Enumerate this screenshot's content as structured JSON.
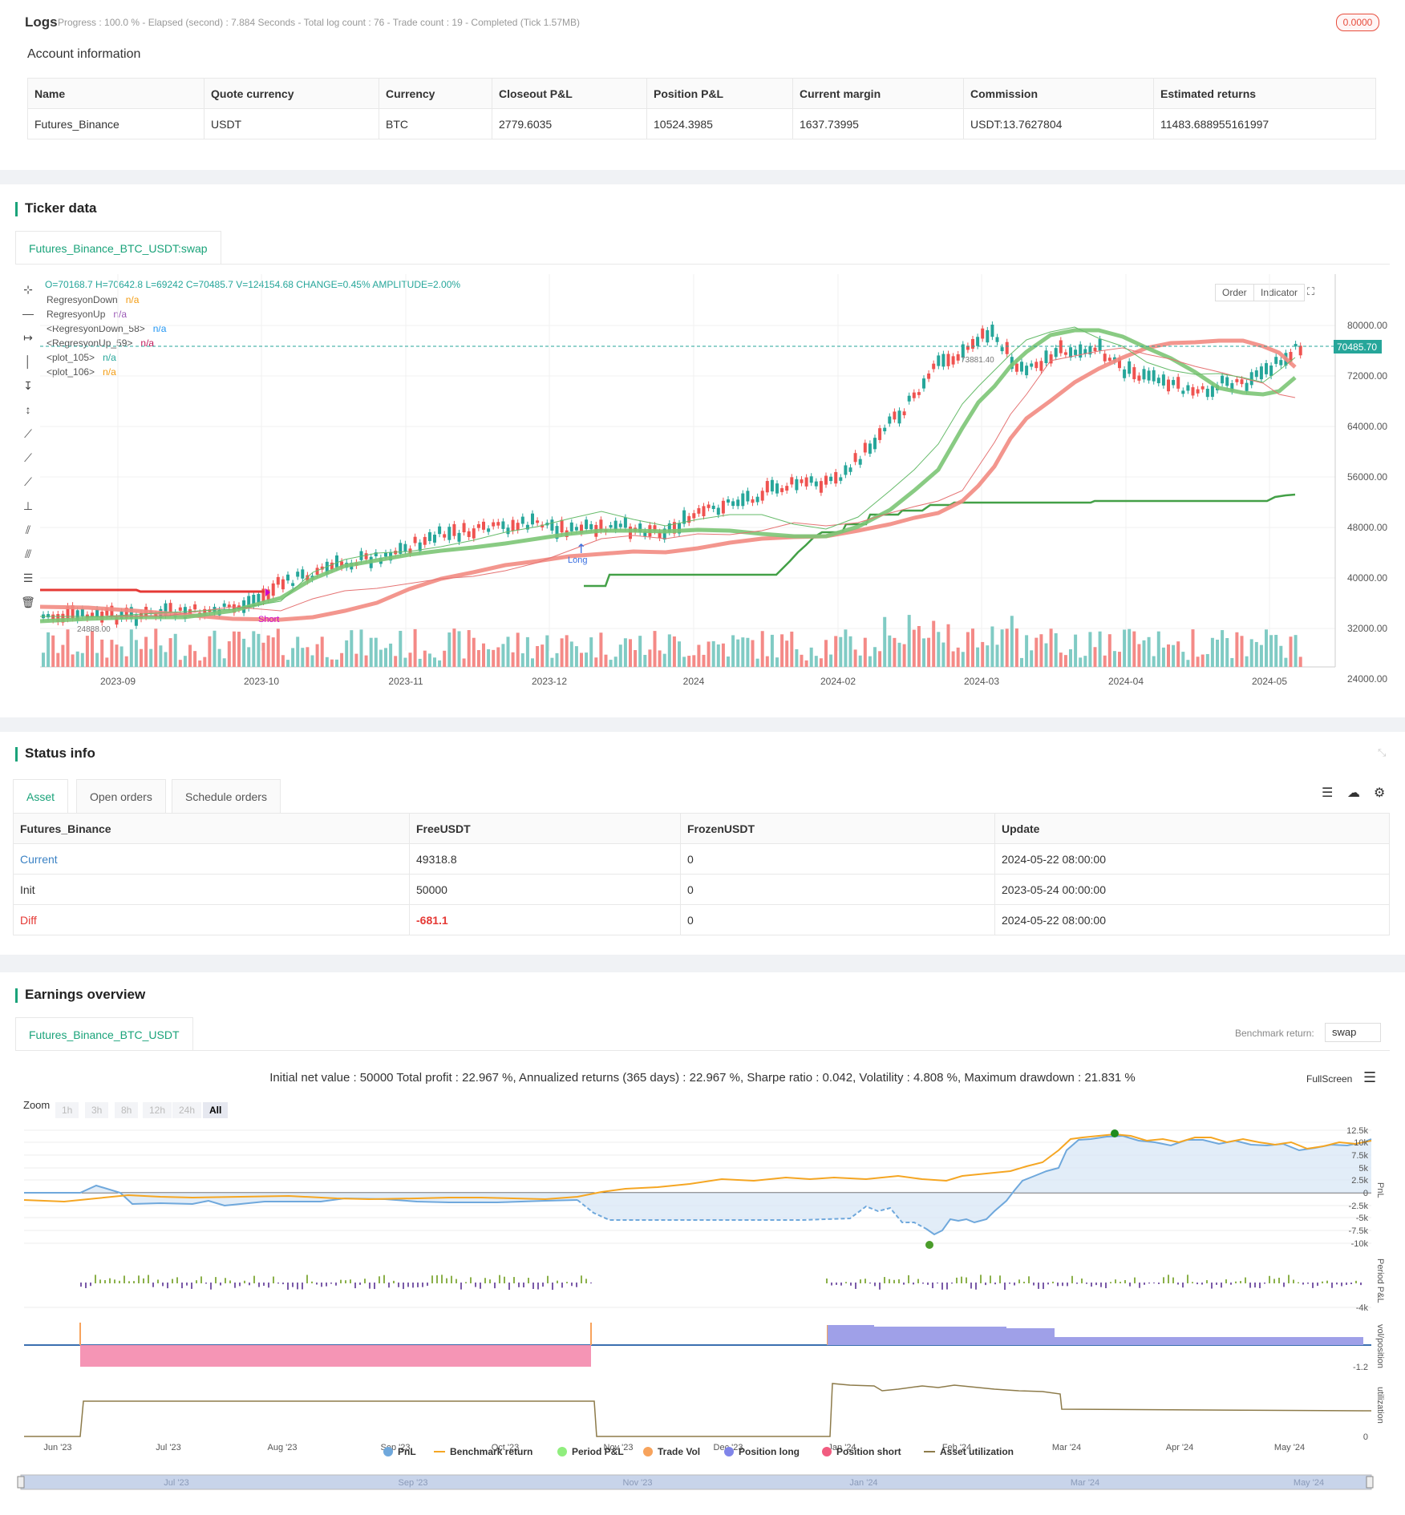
{
  "logs": {
    "title": "Logs",
    "progress": "Progress : 100.0 % - Elapsed (second) : 7.884  Seconds - Total log count : 76 - Trade count : 19 - Completed (Tick 1.57MB)",
    "badge": "0.0000"
  },
  "account": {
    "title": "Account information",
    "headers": [
      "Name",
      "Quote currency",
      "Currency",
      "Closeout P&L",
      "Position P&L",
      "Current margin",
      "Commission",
      "Estimated returns"
    ],
    "row": [
      "Futures_Binance",
      "USDT",
      "BTC",
      "2779.6035",
      "10524.3985",
      "1637.73995",
      "USDT:13.7627804",
      "11483.688955161997"
    ]
  },
  "ticker": {
    "title": "Ticker data",
    "tab": "Futures_Binance_BTC_USDT:swap",
    "ohlc": "O=70168.7 H=70642.8 L=69242 C=70485.7 V=124154.68 CHANGE=0.45% AMPLITUDE=2.00%",
    "indicators": [
      {
        "name": "RegresyonDown",
        "value": "n/a",
        "color": "#f39c12"
      },
      {
        "name": "RegresyonUp",
        "value": "n/a",
        "color": "#9b59b6"
      },
      {
        "name": "<RegresyonDown_58>",
        "value": "n/a",
        "color": "#2196f3"
      },
      {
        "name": "<RegresyonUp_59>",
        "value": "n/a",
        "color": "#c2185b"
      },
      {
        "name": "<plot_105>",
        "value": "n/a",
        "color": "#26a69a"
      },
      {
        "name": "<plot_106>",
        "value": "n/a",
        "color": "#f39c12"
      }
    ],
    "order_btn": "Order",
    "indicator_btn": "Indicator",
    "price_label": "70485.70",
    "high_label": "73881.40",
    "low_label": "24888.00",
    "long_label": "Long",
    "short_label": "Short",
    "y_ticks": [
      "80000.00",
      "72000.00",
      "64000.00",
      "56000.00",
      "48000.00",
      "40000.00",
      "32000.00",
      "24000.00"
    ],
    "x_ticks": [
      "2023-09",
      "2023-10",
      "2023-11",
      "2023-12",
      "2024",
      "2024-02",
      "2024-03",
      "2024-04",
      "2024-05"
    ]
  },
  "status": {
    "title": "Status info",
    "tabs": [
      "Asset",
      "Open orders",
      "Schedule orders"
    ],
    "headers": [
      "Futures_Binance",
      "FreeUSDT",
      "FrozenUSDT",
      "Update"
    ],
    "rows": [
      [
        "Current",
        "49318.8",
        "0",
        "2024-05-22 08:00:00"
      ],
      [
        "Init",
        "50000",
        "0",
        "2023-05-24 00:00:00"
      ],
      [
        "Diff",
        "-681.1",
        "0",
        "2024-05-22 08:00:00"
      ]
    ]
  },
  "earnings": {
    "title": "Earnings overview",
    "tab": "Futures_Binance_BTC_USDT",
    "benchmark_label": "Benchmark return:",
    "benchmark_value": "swap",
    "summary": "Initial net value : 50000 Total profit : 22.967 %, Annualized returns (365 days) : 22.967 %, Sharpe ratio : 0.042, Volatility : 4.808 %, Maximum drawdown : 21.831 %",
    "fullscreen": "FullScreen",
    "zoom_label": "Zoom",
    "zoom_buttons": [
      "1h",
      "3h",
      "8h",
      "12h",
      "24h",
      "All"
    ],
    "pnl_ticks": [
      "12.5k",
      "10k",
      "7.5k",
      "5k",
      "2.5k",
      "0",
      "-2.5k",
      "-5k",
      "-7.5k",
      "-10k"
    ],
    "period_tick": "-4k",
    "pos_tick": "-1.2",
    "util_tick": "0",
    "axis_titles": [
      "PnL",
      "Period P&L",
      "vol/position",
      "utilization"
    ],
    "x_ticks": [
      "Jun '23",
      "Jul '23",
      "Aug '23",
      "Sep '23",
      "Oct '23",
      "Nov '23",
      "Dec '23",
      "Jan '24",
      "Feb '24",
      "Mar '24",
      "Apr '24",
      "May '24"
    ],
    "nav_ticks": [
      "Jul '23",
      "Sep '23",
      "Nov '23",
      "Jan '24",
      "Mar '24",
      "May '24"
    ],
    "legend": [
      {
        "name": "PnL",
        "color": "#6fa8dc"
      },
      {
        "name": "Benchmark return",
        "color": "#f5a623"
      },
      {
        "name": "Period P&L",
        "color": "#90ee7e"
      },
      {
        "name": "Trade Vol",
        "color": "#f7a35c"
      },
      {
        "name": "Position long",
        "color": "#8085e9"
      },
      {
        "name": "Position short",
        "color": "#f15c80"
      },
      {
        "name": "Asset utilization",
        "color": "#8d7b4a"
      }
    ]
  }
}
